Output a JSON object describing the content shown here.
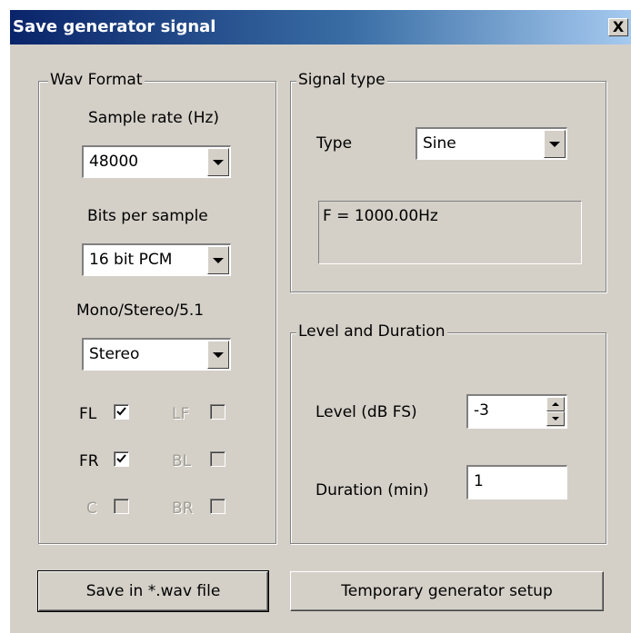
{
  "window": {
    "title": "Save generator signal",
    "close_glyph": "X"
  },
  "wav_format": {
    "legend": "Wav Format",
    "sample_rate": {
      "label": "Sample rate (Hz)",
      "value": "48000"
    },
    "bits_per_sample": {
      "label": "Bits per sample",
      "value": "16 bit PCM"
    },
    "channels_mode": {
      "label": "Mono/Stereo/5.1",
      "value": "Stereo"
    },
    "channels": [
      {
        "label": "FL",
        "checked": true,
        "enabled": true
      },
      {
        "label": "LF",
        "checked": false,
        "enabled": false
      },
      {
        "label": "FR",
        "checked": true,
        "enabled": true
      },
      {
        "label": "BL",
        "checked": false,
        "enabled": false
      },
      {
        "label": "C",
        "checked": false,
        "enabled": false
      },
      {
        "label": "BR",
        "checked": false,
        "enabled": false
      }
    ]
  },
  "signal_type": {
    "legend": "Signal type",
    "type_label": "Type",
    "type_value": "Sine",
    "info": "F = 1000.00Hz"
  },
  "level_duration": {
    "legend": "Level and Duration",
    "level_label": "Level (dB FS)",
    "level_value": "-3",
    "duration_label": "Duration (min)",
    "duration_value": "1"
  },
  "buttons": {
    "save": "Save in *.wav file",
    "temp_setup": "Temporary generator setup"
  },
  "colors": {
    "dialog_bg": "#d4d0c8",
    "title_start": "#0a246a",
    "title_end": "#a6caf0",
    "disabled_text": "#a19e95"
  }
}
